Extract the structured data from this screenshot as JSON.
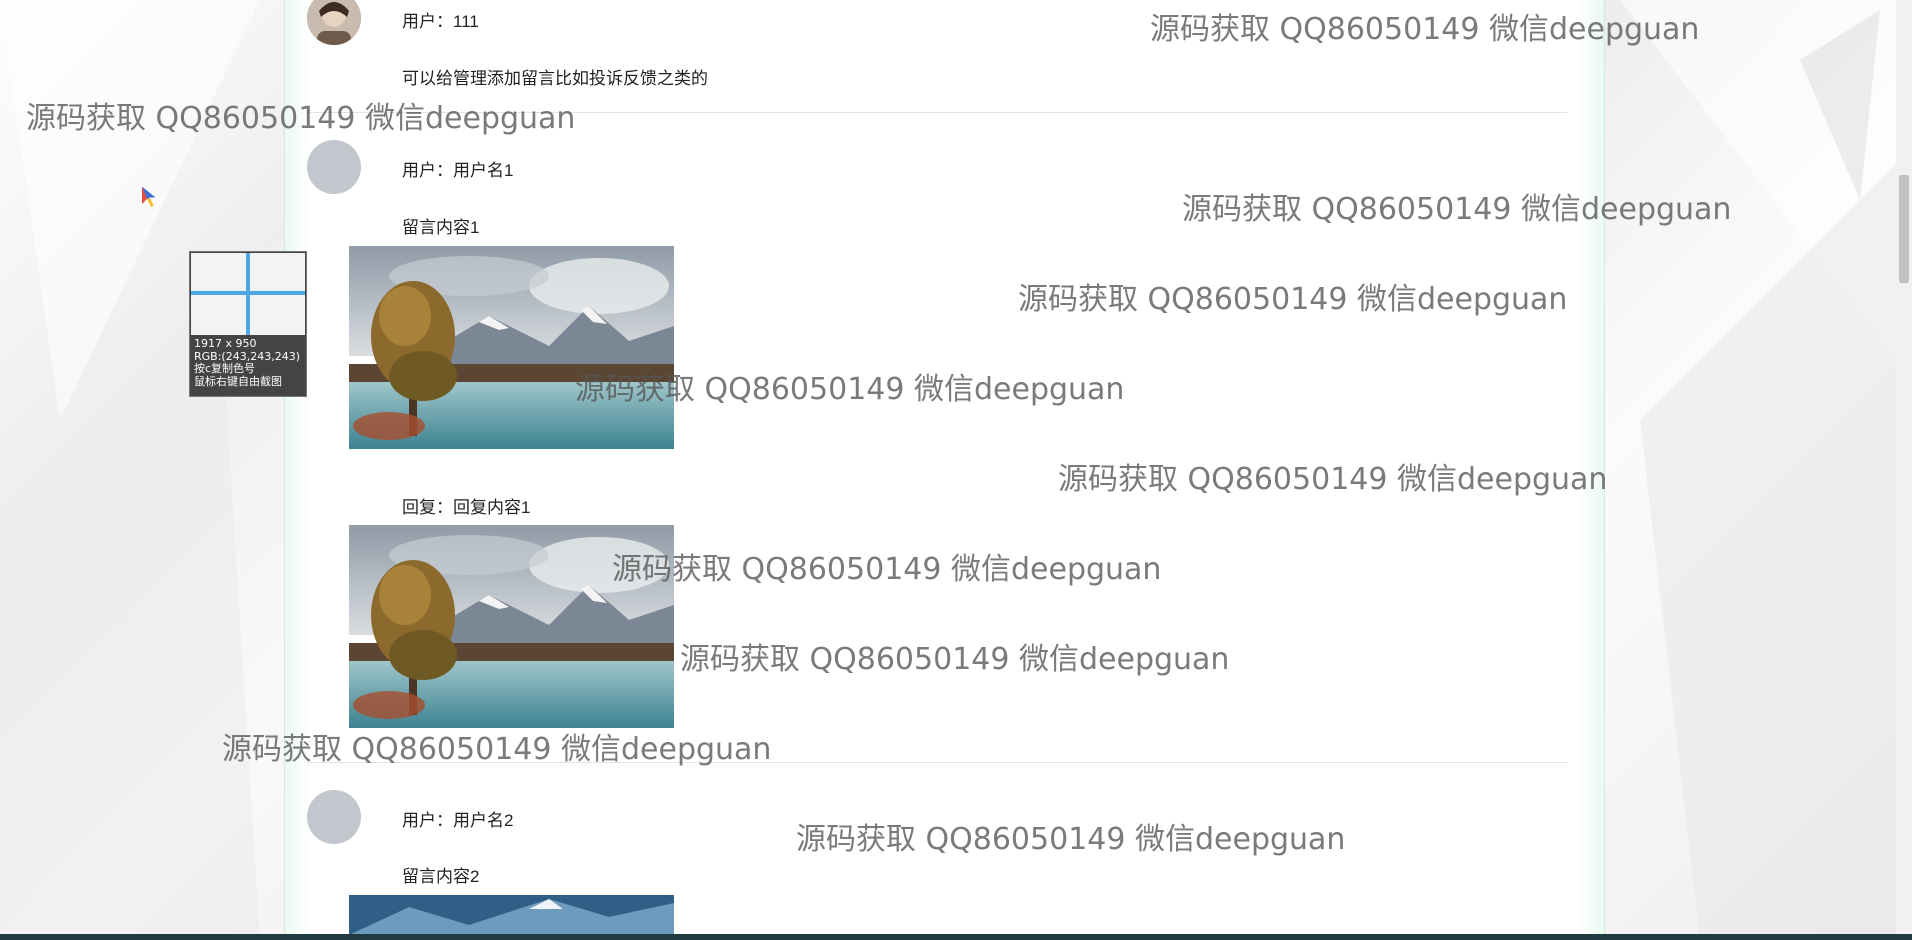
{
  "messages": [
    {
      "user_label": "用户：111",
      "content": "可以给管理添加留言比如投诉反馈之类的",
      "reply": null
    },
    {
      "user_label": "用户：用户名1",
      "content": "留言内容1",
      "reply": "回复：回复内容1"
    },
    {
      "user_label": "用户：用户名2",
      "content": "留言内容2",
      "reply": null
    }
  ],
  "watermark_text": "源码获取 QQ86050149 微信deepguan",
  "magnifier": {
    "size_text": "1917 x 950",
    "rgb_text": "RGB:(243,243,243)",
    "hint_copy": "按c复制色号",
    "hint_capture": "鼠标右键自由截图"
  },
  "colors": {
    "panel_edge": "#ecf9f1",
    "avatar_placeholder": "#c2c6cd",
    "crosshair": "#4ea8e6",
    "taskbar": "#1f3b40"
  }
}
